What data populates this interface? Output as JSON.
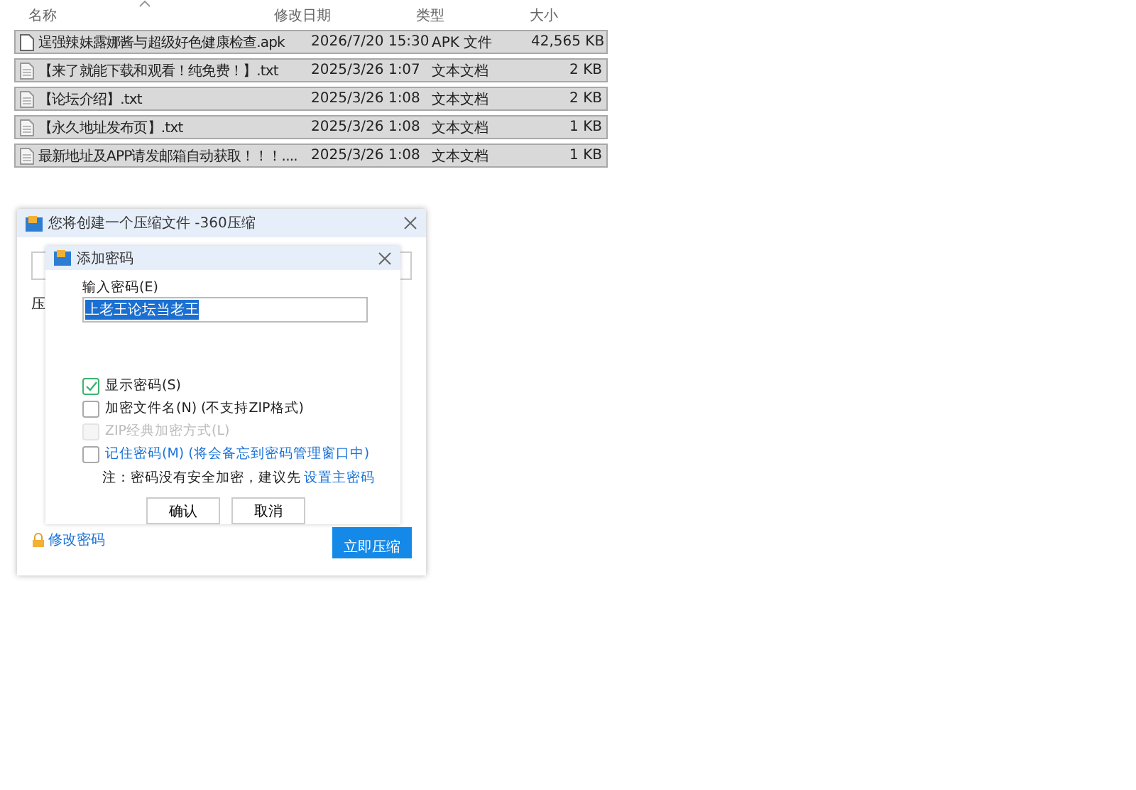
{
  "file_list": {
    "columns": [
      {
        "label": "名称",
        "sorted": true
      },
      {
        "label": "修改日期",
        "sorted": false
      },
      {
        "label": "类型",
        "sorted": false
      },
      {
        "label": "大小",
        "sorted": false
      }
    ],
    "rows": [
      {
        "kind": "apk",
        "name": "逞强辣妹露娜酱与超级好色健康检查.apk",
        "date": "2026/7/20 15:30",
        "type": "APK 文件",
        "size": "42,565 KB"
      },
      {
        "kind": "txt",
        "name": "【来了就能下载和观看！纯免费！】.txt",
        "date": "2025/3/26 1:07",
        "type": "文本文档",
        "size": "2 KB"
      },
      {
        "kind": "txt",
        "name": "【论坛介绍】.txt",
        "date": "2025/3/26 1:08",
        "type": "文本文档",
        "size": "2 KB"
      },
      {
        "kind": "txt",
        "name": "【永久地址发布页】.txt",
        "date": "2025/3/26 1:08",
        "type": "文本文档",
        "size": "1 KB"
      },
      {
        "kind": "txt",
        "name": "最新地址及APP请发邮箱自动获取！！！....",
        "date": "2025/3/26 1:08",
        "type": "文本文档",
        "size": "1 KB"
      }
    ]
  },
  "compress_dialog": {
    "title": "您将创建一个压缩文件 -360压缩",
    "label": "压",
    "change_password_link": "修改密码",
    "compress_button": "立即压缩"
  },
  "password_dialog": {
    "title": "添加密码",
    "field_label": "输入密码(E)",
    "password": "上老王论坛当老王",
    "options": [
      {
        "label": "显示密码(S)",
        "checked": true,
        "disabled": false,
        "link": false
      },
      {
        "label": "加密文件名(N) (不支持ZIP格式)",
        "checked": false,
        "disabled": false,
        "link": false
      },
      {
        "label": "ZIP经典加密方式(L)",
        "checked": false,
        "disabled": true,
        "link": false
      },
      {
        "label": "记住密码(M) (将会备忘到密码管理窗口中)",
        "checked": false,
        "disabled": false,
        "link": true
      }
    ],
    "note": "注：密码没有安全加密，建议先",
    "note_link": "设置主密码",
    "buttons": [
      "确认",
      "取消"
    ]
  }
}
